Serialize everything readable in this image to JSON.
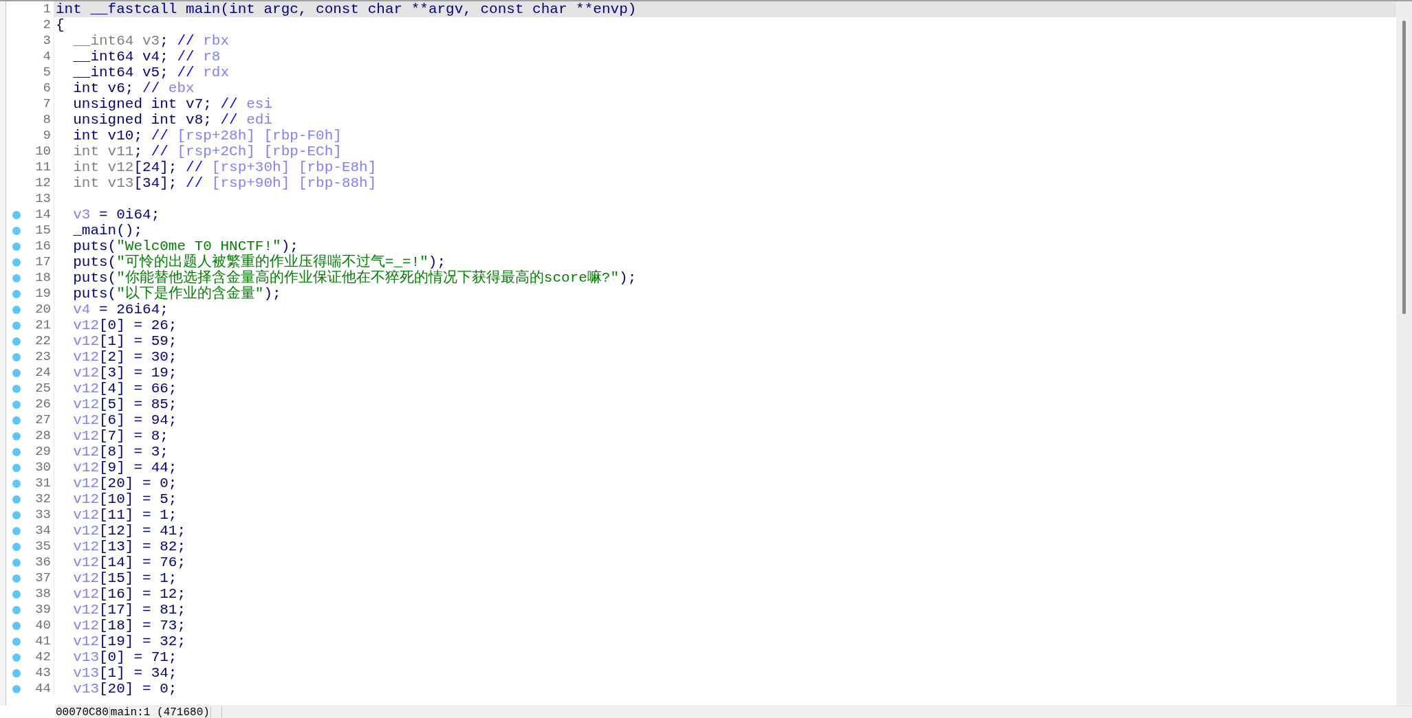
{
  "code_lines": [
    {
      "number": "1",
      "breakpoint": false,
      "current": true,
      "tokens": [
        {
          "kind": "plain",
          "text": "int __fastcall main(int argc, const char **argv, const char **envp)"
        }
      ]
    },
    {
      "number": "2",
      "breakpoint": false,
      "current": false,
      "tokens": [
        {
          "kind": "plain",
          "text": "{"
        }
      ]
    },
    {
      "number": "3",
      "breakpoint": false,
      "current": false,
      "tokens": [
        {
          "kind": "dim",
          "text": "  __int64 v3"
        },
        {
          "kind": "plain",
          "text": "; "
        },
        {
          "kind": "comment",
          "text": "// "
        },
        {
          "kind": "reg",
          "text": "rbx"
        }
      ]
    },
    {
      "number": "4",
      "breakpoint": false,
      "current": false,
      "tokens": [
        {
          "kind": "plain",
          "text": "  __int64 v4; "
        },
        {
          "kind": "comment",
          "text": "// "
        },
        {
          "kind": "reg",
          "text": "r8"
        }
      ]
    },
    {
      "number": "5",
      "breakpoint": false,
      "current": false,
      "tokens": [
        {
          "kind": "plain",
          "text": "  __int64 v5; "
        },
        {
          "kind": "comment",
          "text": "// "
        },
        {
          "kind": "reg",
          "text": "rdx"
        }
      ]
    },
    {
      "number": "6",
      "breakpoint": false,
      "current": false,
      "tokens": [
        {
          "kind": "plain",
          "text": "  int v6; "
        },
        {
          "kind": "comment",
          "text": "// "
        },
        {
          "kind": "reg",
          "text": "ebx"
        }
      ]
    },
    {
      "number": "7",
      "breakpoint": false,
      "current": false,
      "tokens": [
        {
          "kind": "plain",
          "text": "  unsigned int v7; "
        },
        {
          "kind": "comment",
          "text": "// "
        },
        {
          "kind": "reg",
          "text": "esi"
        }
      ]
    },
    {
      "number": "8",
      "breakpoint": false,
      "current": false,
      "tokens": [
        {
          "kind": "plain",
          "text": "  unsigned int v8; "
        },
        {
          "kind": "comment",
          "text": "// "
        },
        {
          "kind": "reg",
          "text": "edi"
        }
      ]
    },
    {
      "number": "9",
      "breakpoint": false,
      "current": false,
      "tokens": [
        {
          "kind": "plain",
          "text": "  int v10; "
        },
        {
          "kind": "comment",
          "text": "// "
        },
        {
          "kind": "reg",
          "text": "[rsp+28h] [rbp-F0h]"
        }
      ]
    },
    {
      "number": "10",
      "breakpoint": false,
      "current": false,
      "tokens": [
        {
          "kind": "dim",
          "text": "  int v11"
        },
        {
          "kind": "plain",
          "text": "; "
        },
        {
          "kind": "comment",
          "text": "// "
        },
        {
          "kind": "reg",
          "text": "[rsp+2Ch] [rbp-ECh]"
        }
      ]
    },
    {
      "number": "11",
      "breakpoint": false,
      "current": false,
      "tokens": [
        {
          "kind": "dim",
          "text": "  int v12"
        },
        {
          "kind": "plain",
          "text": "[24]; "
        },
        {
          "kind": "comment",
          "text": "// "
        },
        {
          "kind": "reg",
          "text": "[rsp+30h] [rbp-E8h]"
        }
      ]
    },
    {
      "number": "12",
      "breakpoint": false,
      "current": false,
      "tokens": [
        {
          "kind": "dim",
          "text": "  int v13"
        },
        {
          "kind": "plain",
          "text": "[34]; "
        },
        {
          "kind": "comment",
          "text": "// "
        },
        {
          "kind": "reg",
          "text": "[rsp+90h] [rbp-88h]"
        }
      ]
    },
    {
      "number": "13",
      "breakpoint": false,
      "current": false
    },
    {
      "number": "14",
      "breakpoint": true,
      "current": false,
      "tokens": [
        {
          "kind": "var",
          "text": "  v3"
        },
        {
          "kind": "plain",
          "text": " = 0i64;"
        }
      ]
    },
    {
      "number": "15",
      "breakpoint": true,
      "current": false,
      "tokens": [
        {
          "kind": "plain",
          "text": "  _main();"
        }
      ]
    },
    {
      "number": "16",
      "breakpoint": true,
      "current": false,
      "tokens": [
        {
          "kind": "plain",
          "text": "  puts("
        },
        {
          "kind": "str",
          "text": "\"Welc0me T0 HNCTF!\""
        },
        {
          "kind": "plain",
          "text": ");"
        }
      ]
    },
    {
      "number": "17",
      "breakpoint": true,
      "current": false,
      "tokens": [
        {
          "kind": "plain",
          "text": "  puts("
        },
        {
          "kind": "str",
          "text": "\"可怜的出题人被繁重的作业压得喘不过气=_=!\""
        },
        {
          "kind": "plain",
          "text": ");"
        }
      ]
    },
    {
      "number": "18",
      "breakpoint": true,
      "current": false,
      "tokens": [
        {
          "kind": "plain",
          "text": "  puts("
        },
        {
          "kind": "str",
          "text": "\"你能替他选择含金量高的作业保证他在不猝死的情况下获得最高的score嘛?\""
        },
        {
          "kind": "plain",
          "text": ");"
        }
      ]
    },
    {
      "number": "19",
      "breakpoint": true,
      "current": false,
      "tokens": [
        {
          "kind": "plain",
          "text": "  puts("
        },
        {
          "kind": "str",
          "text": "\"以下是作业的含金量\""
        },
        {
          "kind": "plain",
          "text": ");"
        }
      ]
    },
    {
      "number": "20",
      "breakpoint": true,
      "current": false,
      "tokens": [
        {
          "kind": "var",
          "text": "  v4"
        },
        {
          "kind": "plain",
          "text": " = 26i64;"
        }
      ]
    },
    {
      "number": "21",
      "breakpoint": true,
      "current": false,
      "tokens": [
        {
          "kind": "var",
          "text": "  v12"
        },
        {
          "kind": "plain",
          "text": "[0] = 26;"
        }
      ]
    },
    {
      "number": "22",
      "breakpoint": true,
      "current": false,
      "tokens": [
        {
          "kind": "var",
          "text": "  v12"
        },
        {
          "kind": "plain",
          "text": "[1] = 59;"
        }
      ]
    },
    {
      "number": "23",
      "breakpoint": true,
      "current": false,
      "tokens": [
        {
          "kind": "var",
          "text": "  v12"
        },
        {
          "kind": "plain",
          "text": "[2] = 30;"
        }
      ]
    },
    {
      "number": "24",
      "breakpoint": true,
      "current": false,
      "tokens": [
        {
          "kind": "var",
          "text": "  v12"
        },
        {
          "kind": "plain",
          "text": "[3] = 19;"
        }
      ]
    },
    {
      "number": "25",
      "breakpoint": true,
      "current": false,
      "tokens": [
        {
          "kind": "var",
          "text": "  v12"
        },
        {
          "kind": "plain",
          "text": "[4] = 66;"
        }
      ]
    },
    {
      "number": "26",
      "breakpoint": true,
      "current": false,
      "tokens": [
        {
          "kind": "var",
          "text": "  v12"
        },
        {
          "kind": "plain",
          "text": "[5] = 85;"
        }
      ]
    },
    {
      "number": "27",
      "breakpoint": true,
      "current": false,
      "tokens": [
        {
          "kind": "var",
          "text": "  v12"
        },
        {
          "kind": "plain",
          "text": "[6] = 94;"
        }
      ]
    },
    {
      "number": "28",
      "breakpoint": true,
      "current": false,
      "tokens": [
        {
          "kind": "var",
          "text": "  v12"
        },
        {
          "kind": "plain",
          "text": "[7] = 8;"
        }
      ]
    },
    {
      "number": "29",
      "breakpoint": true,
      "current": false,
      "tokens": [
        {
          "kind": "var",
          "text": "  v12"
        },
        {
          "kind": "plain",
          "text": "[8] = 3;"
        }
      ]
    },
    {
      "number": "30",
      "breakpoint": true,
      "current": false,
      "tokens": [
        {
          "kind": "var",
          "text": "  v12"
        },
        {
          "kind": "plain",
          "text": "[9] = 44;"
        }
      ]
    },
    {
      "number": "31",
      "breakpoint": true,
      "current": false,
      "tokens": [
        {
          "kind": "var",
          "text": "  v12"
        },
        {
          "kind": "plain",
          "text": "[20] = 0;"
        }
      ]
    },
    {
      "number": "32",
      "breakpoint": true,
      "current": false,
      "tokens": [
        {
          "kind": "var",
          "text": "  v12"
        },
        {
          "kind": "plain",
          "text": "[10] = 5;"
        }
      ]
    },
    {
      "number": "33",
      "breakpoint": true,
      "current": false,
      "tokens": [
        {
          "kind": "var",
          "text": "  v12"
        },
        {
          "kind": "plain",
          "text": "[11] = 1;"
        }
      ]
    },
    {
      "number": "34",
      "breakpoint": true,
      "current": false,
      "tokens": [
        {
          "kind": "var",
          "text": "  v12"
        },
        {
          "kind": "plain",
          "text": "[12] = 41;"
        }
      ]
    },
    {
      "number": "35",
      "breakpoint": true,
      "current": false,
      "tokens": [
        {
          "kind": "var",
          "text": "  v12"
        },
        {
          "kind": "plain",
          "text": "[13] = 82;"
        }
      ]
    },
    {
      "number": "36",
      "breakpoint": true,
      "current": false,
      "tokens": [
        {
          "kind": "var",
          "text": "  v12"
        },
        {
          "kind": "plain",
          "text": "[14] = 76;"
        }
      ]
    },
    {
      "number": "37",
      "breakpoint": true,
      "current": false,
      "tokens": [
        {
          "kind": "var",
          "text": "  v12"
        },
        {
          "kind": "plain",
          "text": "[15] = 1;"
        }
      ]
    },
    {
      "number": "38",
      "breakpoint": true,
      "current": false,
      "tokens": [
        {
          "kind": "var",
          "text": "  v12"
        },
        {
          "kind": "plain",
          "text": "[16] = 12;"
        }
      ]
    },
    {
      "number": "39",
      "breakpoint": true,
      "current": false,
      "tokens": [
        {
          "kind": "var",
          "text": "  v12"
        },
        {
          "kind": "plain",
          "text": "[17] = 81;"
        }
      ]
    },
    {
      "number": "40",
      "breakpoint": true,
      "current": false,
      "tokens": [
        {
          "kind": "var",
          "text": "  v12"
        },
        {
          "kind": "plain",
          "text": "[18] = 73;"
        }
      ]
    },
    {
      "number": "41",
      "breakpoint": true,
      "current": false,
      "tokens": [
        {
          "kind": "var",
          "text": "  v12"
        },
        {
          "kind": "plain",
          "text": "[19] = 32;"
        }
      ]
    },
    {
      "number": "42",
      "breakpoint": true,
      "current": false,
      "tokens": [
        {
          "kind": "var",
          "text": "  v13"
        },
        {
          "kind": "plain",
          "text": "[0] = 71;"
        }
      ]
    },
    {
      "number": "43",
      "breakpoint": true,
      "current": false,
      "tokens": [
        {
          "kind": "var",
          "text": "  v13"
        },
        {
          "kind": "plain",
          "text": "[1] = 34;"
        }
      ]
    },
    {
      "number": "44",
      "breakpoint": true,
      "current": false,
      "tokens": [
        {
          "kind": "var",
          "text": "  v13"
        },
        {
          "kind": "plain",
          "text": "[20] = 0;"
        }
      ]
    }
  ],
  "status_bar": {
    "address": "00070C80",
    "location": "main:1 (471680)"
  }
}
